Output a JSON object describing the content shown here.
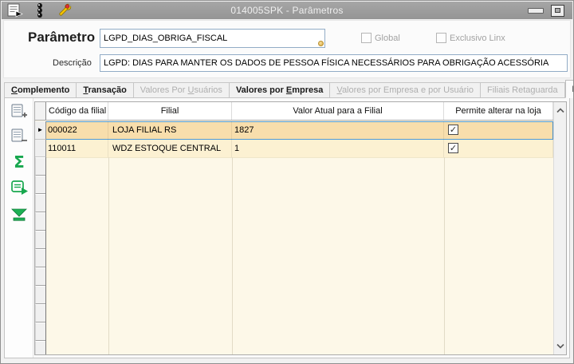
{
  "window": {
    "title": "014005SPK - Parâmetros"
  },
  "titlebar": {
    "icons": [
      "form-arrow-icon",
      "traffic-light-icon",
      "wrench-icon"
    ],
    "buttons": [
      "minimize-button",
      "maximize-button"
    ]
  },
  "form": {
    "parametro_label": "Parâmetro",
    "parametro_value": "LGPD_DIAS_OBRIGA_FISCAL",
    "descricao_label": "Descrição",
    "descricao_value": "LGPD: DIAS PARA MANTER OS DADOS DE PESSOA FÍSICA NECESSÁRIOS PARA OBRIGAÇÃO ACESSÓRIA",
    "global_label": "Global",
    "global_checked": false,
    "exclusivo_label": "Exclusivo Linx",
    "exclusivo_checked": false
  },
  "tabs": [
    {
      "pre": "",
      "accel": "C",
      "post": "omplemento",
      "state": "enabled"
    },
    {
      "pre": "",
      "accel": "T",
      "post": "ransação",
      "state": "enabled"
    },
    {
      "pre": "Valores Por ",
      "accel": "U",
      "post": "suários",
      "state": "disabled"
    },
    {
      "pre": "Valores por ",
      "accel": "E",
      "post": "mpresa",
      "state": "enabled"
    },
    {
      "pre": "",
      "accel": "V",
      "post": "alores por Empresa e por Usuário",
      "state": "disabled"
    },
    {
      "pre": "",
      "accel": "",
      "post": "Filiais Retaguarda",
      "state": "disabled"
    },
    {
      "pre": "",
      "accel": "",
      "post": "Filiais Loja",
      "state": "active"
    }
  ],
  "grid": {
    "columns": [
      "Código da filial",
      "Filial",
      "Valor Atual para a Filial",
      "Permite alterar na loja"
    ],
    "rows": [
      {
        "codigo": "000022",
        "filial": "LOJA FILIAL RS",
        "valor": "1827",
        "permite": true,
        "selected": true
      },
      {
        "codigo": "110011",
        "filial": "WDZ ESTOQUE CENTRAL",
        "valor": "1",
        "permite": true,
        "selected": false
      }
    ]
  },
  "toolbar": {
    "buttons": [
      "add-record-button",
      "delete-record-button",
      "sum-button",
      "execute-button",
      "last-record-button"
    ]
  },
  "icons": {
    "checkmark": "✓",
    "row_pointer": "►",
    "sum_glyph": "Σ"
  },
  "colors": {
    "titlebar": "#9B9B9B",
    "selected_row": "#F8DEAC",
    "row_alt": "#FCF1D2",
    "grid_empty": "#FDF8E8",
    "selection_border": "#4E9AD5",
    "toolbar_green": "#17A74E",
    "input_border": "#92ACC6",
    "disabled_text": "#AFAFAF",
    "wrench_yellow": "#F5C400",
    "wrench_dot_red": "#E03131"
  }
}
